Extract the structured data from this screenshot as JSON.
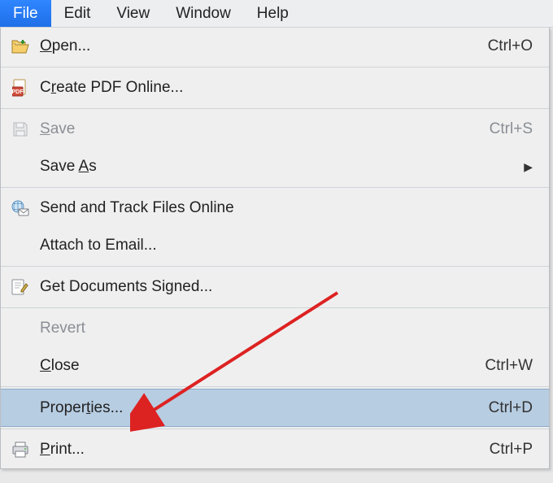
{
  "menubar": {
    "file": "File",
    "edit": "Edit",
    "view": "View",
    "window": "Window",
    "help": "Help"
  },
  "menu": {
    "open": {
      "pre": "",
      "mn": "O",
      "post": "pen...",
      "shortcut": "Ctrl+O"
    },
    "create_pdf": {
      "pre": "C",
      "mn": "r",
      "post": "eate PDF Online..."
    },
    "save": {
      "pre": "",
      "mn": "S",
      "post": "ave",
      "shortcut": "Ctrl+S"
    },
    "save_as": {
      "pre": "Save ",
      "mn": "A",
      "post": "s"
    },
    "send_track": {
      "label": "Send and Track Files Online"
    },
    "attach_email": {
      "label": "Attach to Email..."
    },
    "get_signed": {
      "label": "Get Documents Signed..."
    },
    "revert": {
      "label": "Revert"
    },
    "close": {
      "pre": "",
      "mn": "C",
      "post": "lose",
      "shortcut": "Ctrl+W"
    },
    "properties": {
      "pre": "Proper",
      "mn": "t",
      "post": "ies...",
      "shortcut": "Ctrl+D"
    },
    "print": {
      "pre": "",
      "mn": "P",
      "post": "rint...",
      "shortcut": "Ctrl+P"
    }
  }
}
